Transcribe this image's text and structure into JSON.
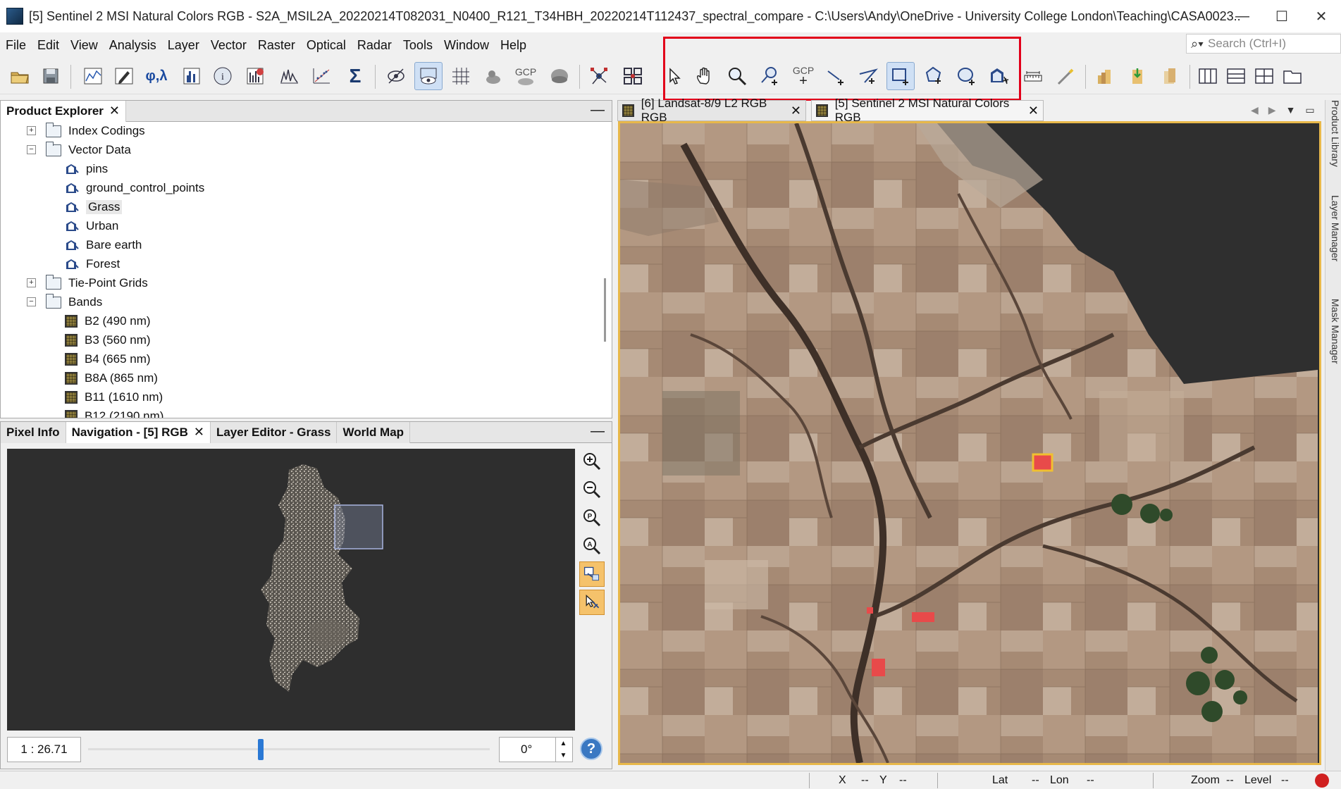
{
  "window": {
    "title": "[5] Sentinel 2 MSI Natural Colors RGB - S2A_MSIL2A_20220214T082031_N0400_R121_T34HBH_20220214T112437_spectral_compare - C:\\Users\\Andy\\OneDrive - University College London\\Teaching\\CASA0023...",
    "minimize": "—",
    "maximize": "☐",
    "close": "✕"
  },
  "menu": [
    "File",
    "Edit",
    "View",
    "Analysis",
    "Layer",
    "Vector",
    "Raster",
    "Optical",
    "Radar",
    "Tools",
    "Window",
    "Help"
  ],
  "search": {
    "placeholder": "Search (Ctrl+I)"
  },
  "toolbar": {
    "gcp_label": "GCP",
    "gcp_tool_label": "GCP"
  },
  "product_explorer": {
    "tab": "Product Explorer",
    "close": "✕",
    "minimize": "—",
    "tree": [
      {
        "label": "Index Codings",
        "type": "folder",
        "state": "collapsed"
      },
      {
        "label": "Vector Data",
        "type": "folder",
        "state": "expanded"
      },
      {
        "label": "pins",
        "type": "vector"
      },
      {
        "label": "ground_control_points",
        "type": "vector"
      },
      {
        "label": "Grass",
        "type": "vector",
        "selected": true
      },
      {
        "label": "Urban",
        "type": "vector"
      },
      {
        "label": "Bare earth",
        "type": "vector"
      },
      {
        "label": "Forest",
        "type": "vector"
      },
      {
        "label": "Tie-Point Grids",
        "type": "folder",
        "state": "collapsed"
      },
      {
        "label": "Bands",
        "type": "folder",
        "state": "expanded"
      },
      {
        "label": "B2 (490 nm)",
        "type": "band"
      },
      {
        "label": "B3 (560 nm)",
        "type": "band"
      },
      {
        "label": "B4 (665 nm)",
        "type": "band"
      },
      {
        "label": "B8A (865 nm)",
        "type": "band"
      },
      {
        "label": "B11 (1610 nm)",
        "type": "band"
      },
      {
        "label": "B12 (2190 nm)",
        "type": "band"
      }
    ]
  },
  "bottom_panel": {
    "tabs": [
      "Pixel Info",
      "Navigation - [5] RGB",
      "Layer Editor - Grass",
      "World Map"
    ],
    "active_tab": "Navigation - [5] RGB",
    "close": "✕",
    "minimize": "—",
    "scale": "1 : 26.71",
    "rotation": "0°",
    "help": "?",
    "zoom_slider_fraction": 0.43
  },
  "view_tabs": [
    {
      "label": "[6] Landsat-8/9 L2 RGB RGB",
      "close": "✕"
    },
    {
      "label": "[5] Sentinel 2 MSI Natural Colors RGB",
      "close": "✕",
      "active": true
    }
  ],
  "side_tabs": [
    "Product Library",
    "Layer Manager",
    "Mask Manager"
  ],
  "status": {
    "x_label": "X",
    "x_val": "--",
    "y_label": "Y",
    "y_val": "--",
    "lat_label": "Lat",
    "lat_val": "--",
    "lon_label": "Lon",
    "lon_val": "--",
    "zoom_label": "Zoom",
    "zoom_val": "--",
    "level_label": "Level",
    "level_val": "--"
  },
  "colors": {
    "highlight": "#e2001a",
    "view_border": "#e8b84a",
    "mask_grass": "#e84a4a"
  }
}
